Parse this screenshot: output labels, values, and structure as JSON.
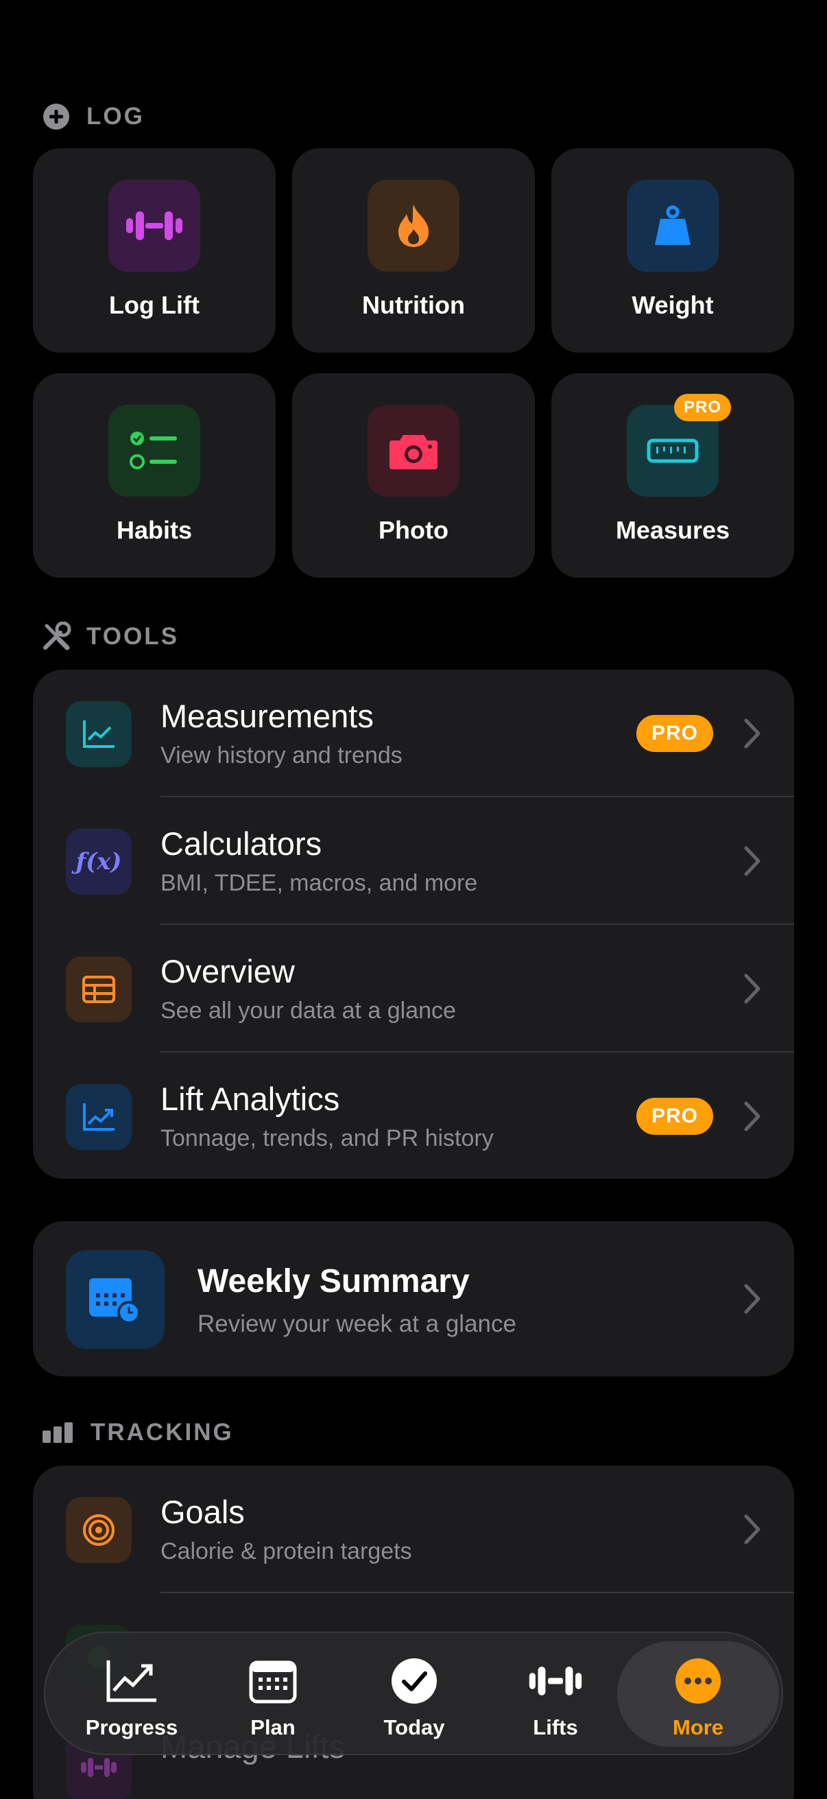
{
  "log": {
    "header": "LOG",
    "tiles": [
      {
        "label": "Log Lift"
      },
      {
        "label": "Nutrition"
      },
      {
        "label": "Weight"
      },
      {
        "label": "Habits"
      },
      {
        "label": "Photo"
      },
      {
        "label": "Measures",
        "badge": "PRO"
      }
    ]
  },
  "tools": {
    "header": "TOOLS",
    "items": [
      {
        "title": "Measurements",
        "subtitle": "View history and trends",
        "badge": "PRO"
      },
      {
        "title": "Calculators",
        "subtitle": "BMI, TDEE, macros, and more",
        "icon_text": "ƒ(x)"
      },
      {
        "title": "Overview",
        "subtitle": "See all your data at a glance"
      },
      {
        "title": "Lift Analytics",
        "subtitle": "Tonnage, trends, and PR history",
        "badge": "PRO"
      }
    ]
  },
  "weekly_summary": {
    "title": "Weekly Summary",
    "subtitle": "Review your week at a glance"
  },
  "tracking": {
    "header": "TRACKING",
    "items": [
      {
        "title": "Goals",
        "subtitle": "Calorie & protein targets"
      }
    ],
    "partial_rows": [
      {
        "title": "Manage Lifts"
      }
    ]
  },
  "tabbar": {
    "tabs": [
      {
        "label": "Progress"
      },
      {
        "label": "Plan"
      },
      {
        "label": "Today"
      },
      {
        "label": "Lifts"
      },
      {
        "label": "More",
        "active": true
      }
    ]
  },
  "colors": {
    "accent": "#ff9f0a",
    "background": "#000000",
    "card": "#1c1c1e",
    "secondary_text": "#8e8e93"
  }
}
